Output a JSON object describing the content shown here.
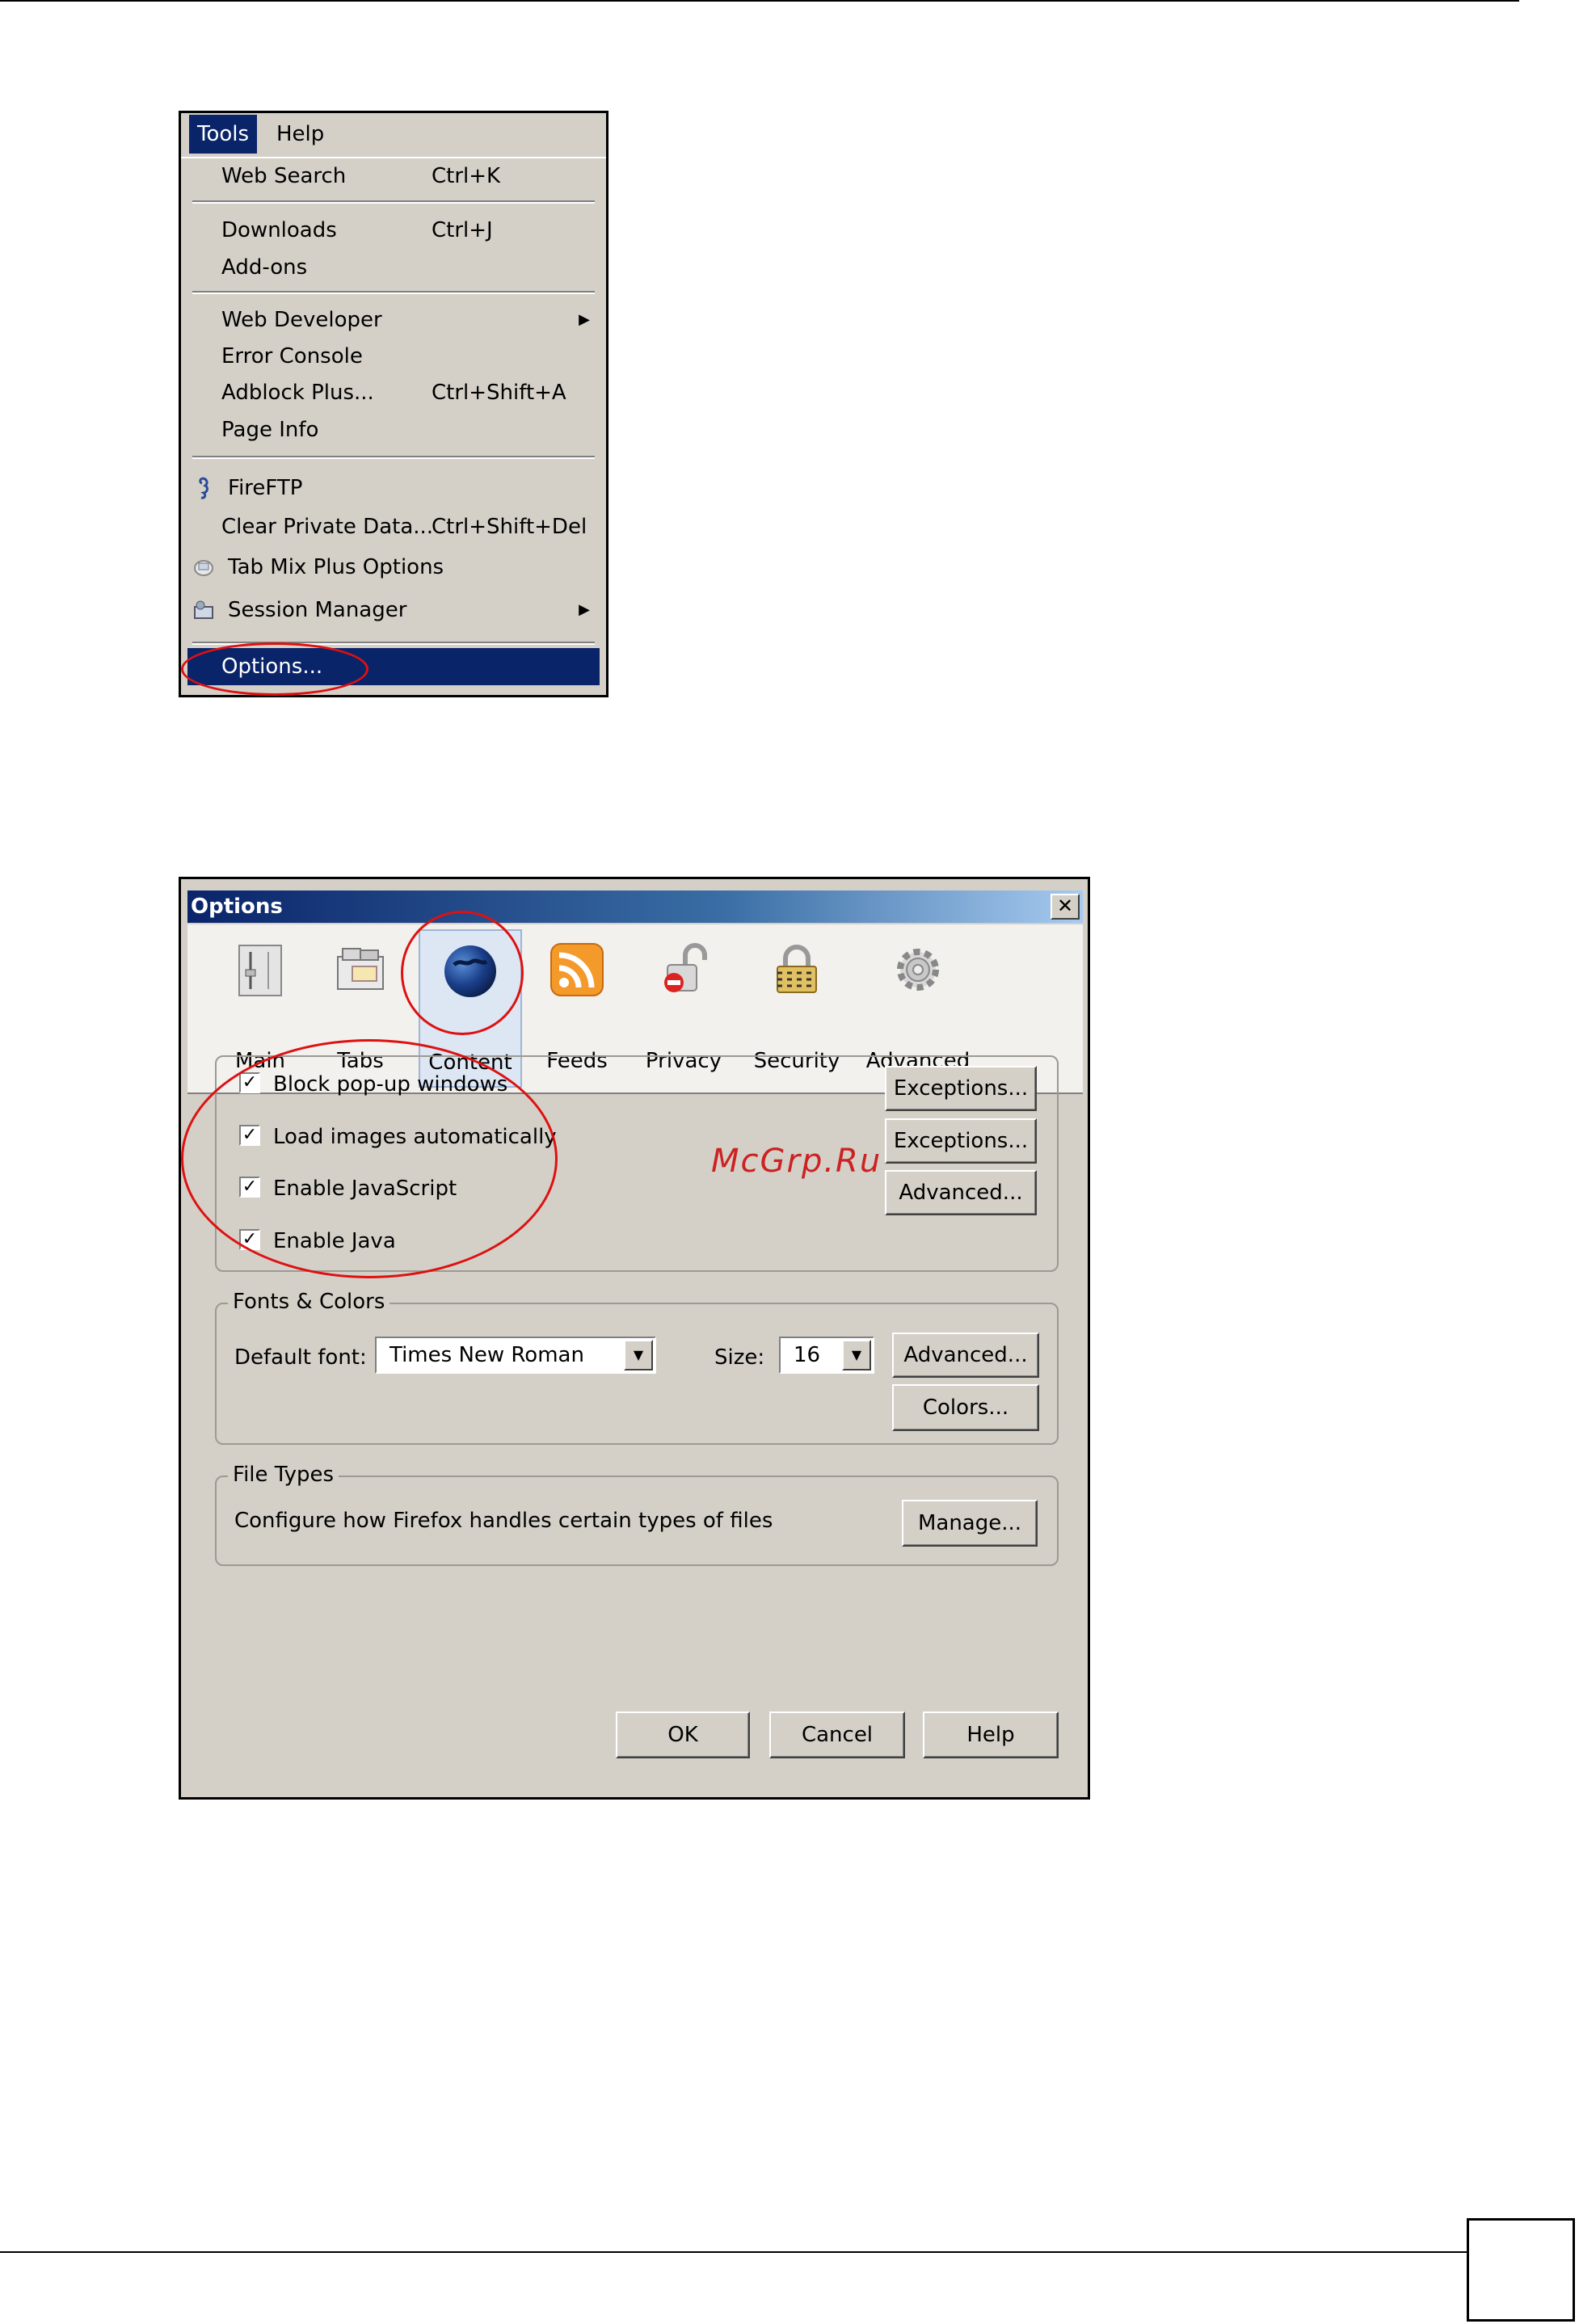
{
  "tools_menu": {
    "menubar": [
      "Tools",
      "Help"
    ],
    "items": [
      {
        "label": "Web Search",
        "accel": "Ctrl+K"
      },
      {
        "label": "Downloads",
        "accel": "Ctrl+J"
      },
      {
        "label": "Add-ons",
        "accel": ""
      },
      {
        "label": "Web Developer",
        "accel": "",
        "submenu": true
      },
      {
        "label": "Error Console",
        "accel": ""
      },
      {
        "label": "Adblock Plus...",
        "accel": "Ctrl+Shift+A"
      },
      {
        "label": "Page Info",
        "accel": ""
      },
      {
        "label": "FireFTP",
        "accel": "",
        "icon": "seahorse-icon"
      },
      {
        "label": "Clear Private Data...",
        "accel": "Ctrl+Shift+Del"
      },
      {
        "label": "Tab Mix Plus Options",
        "accel": "",
        "icon": "tabmix-icon"
      },
      {
        "label": "Session Manager",
        "accel": "",
        "icon": "session-manager-icon",
        "submenu": true
      },
      {
        "label": "Options...",
        "accel": "",
        "highlighted": true
      }
    ]
  },
  "options_dialog": {
    "title": "Options",
    "tabs": [
      {
        "label": "Main",
        "icon": "main-switch-icon"
      },
      {
        "label": "Tabs",
        "icon": "tabs-icon"
      },
      {
        "label": "Content",
        "icon": "globe-icon",
        "selected": true
      },
      {
        "label": "Feeds",
        "icon": "rss-icon"
      },
      {
        "label": "Privacy",
        "icon": "padlock-open-icon"
      },
      {
        "label": "Security",
        "icon": "padlock-icon"
      },
      {
        "label": "Advanced",
        "icon": "gear-icon"
      }
    ],
    "content": {
      "checkboxes": [
        {
          "label": "Block pop-up windows",
          "checked": true
        },
        {
          "label": "Load images automatically",
          "checked": true
        },
        {
          "label": "Enable JavaScript",
          "checked": true
        },
        {
          "label": "Enable Java",
          "checked": true
        }
      ],
      "side_buttons": [
        "Exceptions...",
        "Exceptions...",
        "Advanced..."
      ]
    },
    "fonts_colors": {
      "legend": "Fonts & Colors",
      "default_font_label": "Default font:",
      "default_font_value": "Times New Roman",
      "size_label": "Size:",
      "size_value": "16",
      "advanced_button": "Advanced...",
      "colors_button": "Colors..."
    },
    "file_types": {
      "legend": "File Types",
      "description": "Configure how Firefox handles certain types of files",
      "manage_button": "Manage..."
    },
    "buttons": {
      "ok": "OK",
      "cancel": "Cancel",
      "help": "Help"
    }
  },
  "watermark": "McGrp.Ru",
  "colors": {
    "highlight": "#0a246a",
    "annotation_red": "#dd1111",
    "dialog_bg": "#d4d0c8"
  }
}
